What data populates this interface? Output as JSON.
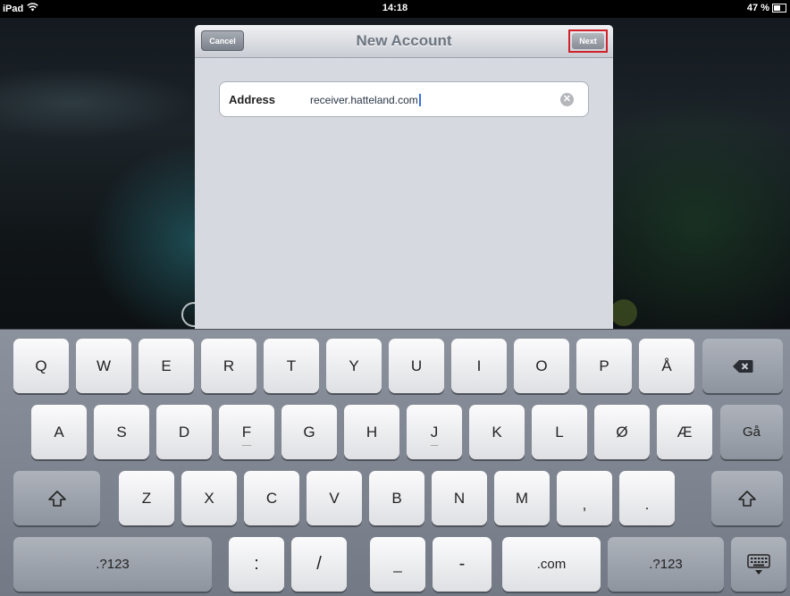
{
  "status_bar": {
    "device": "iPad",
    "time": "14:18",
    "battery": "47 %",
    "battery_level": 0.47
  },
  "dialog": {
    "title": "New Account",
    "cancel_label": "Cancel",
    "next_label": "Next",
    "field": {
      "label": "Address",
      "value": "receiver.hatteland.com",
      "clear_icon": "clear-icon"
    }
  },
  "keyboard": {
    "row1": [
      "Q",
      "W",
      "E",
      "R",
      "T",
      "Y",
      "U",
      "I",
      "O",
      "P",
      "Å"
    ],
    "row2": [
      "A",
      "S",
      "D",
      "F",
      "G",
      "H",
      "J",
      "K",
      "L",
      "Ø",
      "Æ"
    ],
    "go_label": "Gå",
    "row3": [
      "Z",
      "X",
      "C",
      "V",
      "B",
      "N",
      "M",
      ",",
      "."
    ],
    "numbers_label": ".?123",
    "colon": ":",
    "slash": "/",
    "underscore": "_",
    "dash": "-",
    "dotcom": ".com",
    "numbers_label_right": ".?123",
    "icons": [
      "backspace-icon",
      "shift-icon",
      "hide-keyboard-icon"
    ]
  },
  "colors": {
    "highlight": "#d0202a",
    "cursor": "#3a6fe0"
  }
}
